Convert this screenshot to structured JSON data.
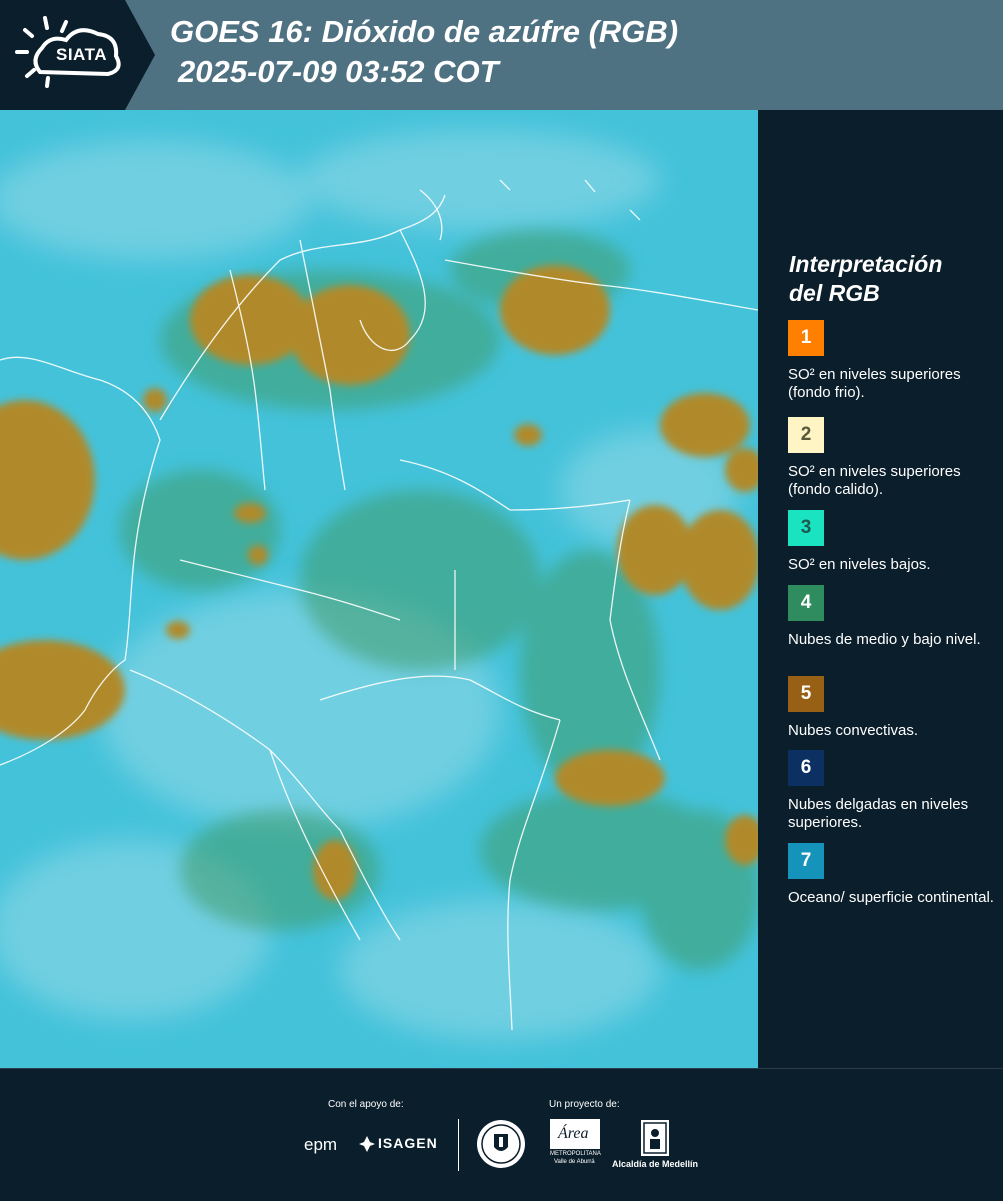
{
  "header": {
    "logo_text": "SIATA",
    "title_line1": "GOES 16: Dióxido de azúfre (RGB)",
    "title_line2": "2025-07-09 03:52 COT"
  },
  "legend": {
    "title_line1": "Interpretación",
    "title_line2": "del RGB",
    "items": [
      {
        "number": "1",
        "color": "#ff7f00",
        "text": "SO² en niveles superiores (fondo frio)."
      },
      {
        "number": "2",
        "color": "#fff5c4",
        "text": "SO² en niveles superiores (fondo calido)."
      },
      {
        "number": "3",
        "color": "#19e3c1",
        "text": "SO² en niveles bajos."
      },
      {
        "number": "4",
        "color": "#2e8c5e",
        "text": "Nubes de medio y bajo nivel."
      },
      {
        "number": "5",
        "color": "#986014",
        "text": "Nubes convectivas."
      },
      {
        "number": "6",
        "color": "#0c3062",
        "text": "Nubes delgadas en niveles superiores."
      },
      {
        "number": "7",
        "color": "#1593bb",
        "text": "Oceano/ superficie continental."
      }
    ]
  },
  "footer": {
    "support_label": "Con el apoyo de:",
    "project_label": "Un proyecto de:",
    "sponsor1": "epm",
    "sponsor2": "ISAGEN",
    "area_logo_text": "Área",
    "area_logo_subtext": "METROPOLITANA",
    "area_logo_subtext2": "Valle de Aburrá",
    "alcaldia": "Alcaldía de Medellín"
  },
  "colors": {
    "header_bg": "#4f7282",
    "panel_bg": "#0b1e2b",
    "ocean": "#43c2da",
    "cloud": "#b48a2c"
  }
}
